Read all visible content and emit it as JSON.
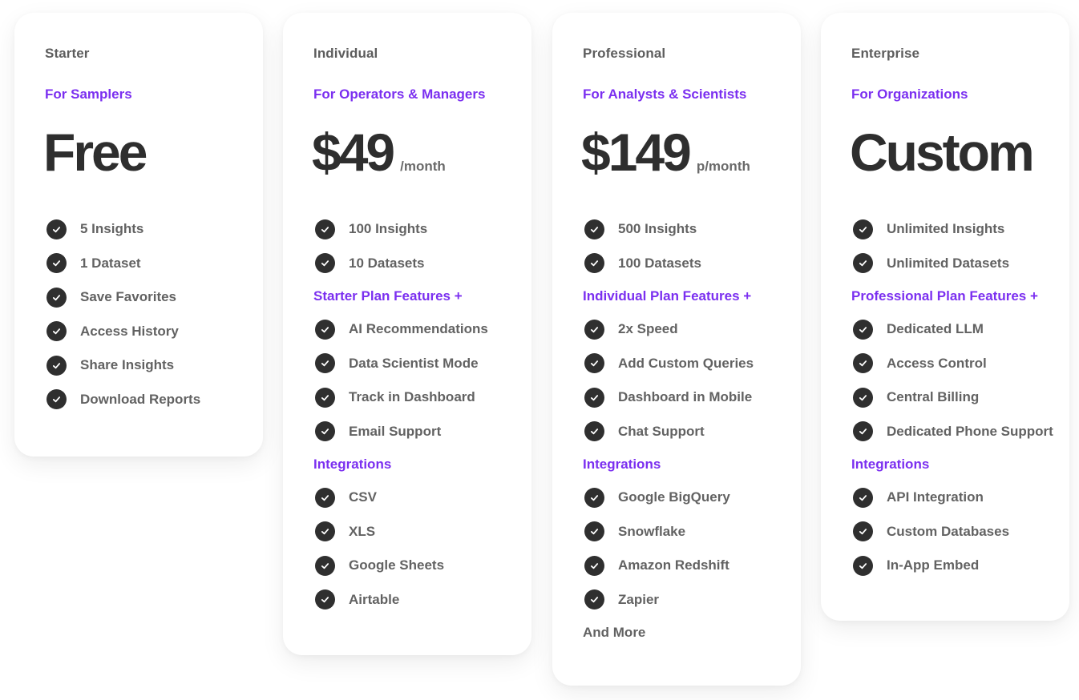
{
  "theme": {
    "accent": "#7b2ff0",
    "price_text": "#2e2e2e",
    "body_text": "#626262",
    "check_bg": "#2f2f2f",
    "card_bg": "#ffffff"
  },
  "icons": {
    "check": "check-circle-icon"
  },
  "plans": [
    {
      "name": "Starter",
      "audience": "For Samplers",
      "price": "Free",
      "period": "",
      "base_features": [
        "5 Insights",
        "1 Dataset",
        "Save Favorites",
        "Access History",
        "Share Insights",
        "Download Reports"
      ]
    },
    {
      "name": "Individual",
      "audience": "For Operators & Managers",
      "price": "$49",
      "period": "/month",
      "base_features": [
        "100 Insights",
        "10 Datasets"
      ],
      "plus_heading": "Starter Plan Features +",
      "plus_features": [
        "AI Recommendations",
        "Data Scientist Mode",
        "Track in Dashboard",
        "Email Support"
      ],
      "integrations_heading": "Integrations",
      "integrations": [
        "CSV",
        "XLS",
        "Google Sheets",
        "Airtable"
      ]
    },
    {
      "name": "Professional",
      "audience": "For Analysts & Scientists",
      "price": "$149",
      "period": "p/month",
      "base_features": [
        "500 Insights",
        "100 Datasets"
      ],
      "plus_heading": "Individual Plan Features +",
      "plus_features": [
        "2x Speed",
        "Add Custom Queries",
        "Dashboard in Mobile",
        "Chat Support"
      ],
      "integrations_heading": "Integrations",
      "integrations": [
        "Google BigQuery",
        "Snowflake",
        "Amazon Redshift",
        "Zapier"
      ],
      "footer_note": "And More"
    },
    {
      "name": "Enterprise",
      "audience": "For Organizations",
      "price": "Custom",
      "period": "",
      "base_features": [
        "Unlimited Insights",
        "Unlimited Datasets"
      ],
      "plus_heading": "Professional Plan Features +",
      "plus_features": [
        "Dedicated LLM",
        "Access Control",
        "Central Billing",
        "Dedicated Phone Support"
      ],
      "integrations_heading": "Integrations",
      "integrations": [
        "API Integration",
        "Custom Databases",
        "In-App Embed"
      ]
    }
  ]
}
